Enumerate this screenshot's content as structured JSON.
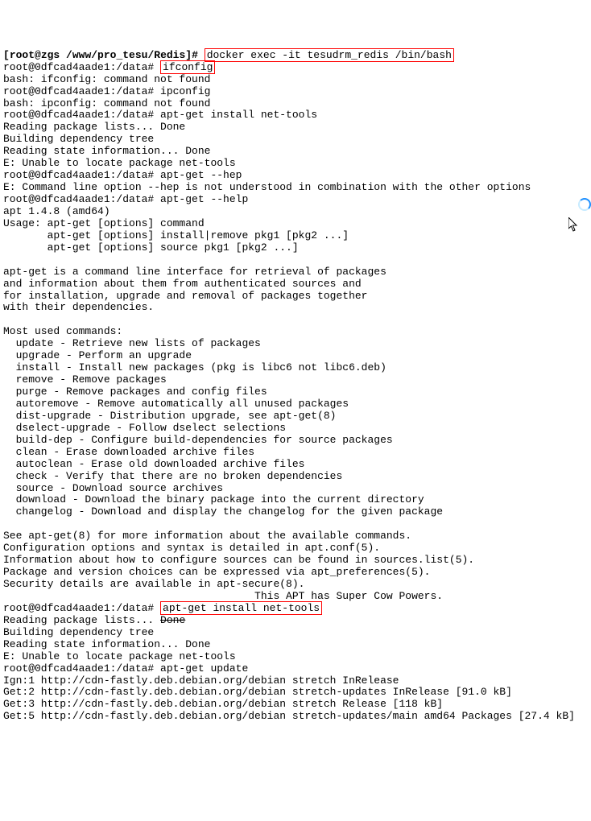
{
  "lines": {
    "l0_a": "[",
    "l0_b": "root@zgs",
    "l0_c": " /www/pro_tesu/",
    "l0_d": "Redis",
    "l0_e": "]# ",
    "l0_cmd": "docker exec -it tesudrm_redis /bin/bash",
    "l1_a": "root@0dfcad4aade1:/data# ",
    "l1_cmd": "ifconfig",
    "l2": "bash: ifconfig: command not found",
    "l3": "root@0dfcad4aade1:/data# ipconfig",
    "l4": "bash: ipconfig: command not found",
    "l5": "root@0dfcad4aade1:/data# apt-get install net-tools",
    "l6": "Reading package lists... Done",
    "l7": "Building dependency tree",
    "l8": "Reading state information... Done",
    "l9": "E: Unable to locate package net-tools",
    "l10": "root@0dfcad4aade1:/data# apt-get --hep",
    "l11": "E: Command line option --hep is not understood in combination with the other options",
    "l12": "root@0dfcad4aade1:/data# apt-get --help",
    "l13": "apt 1.4.8 (amd64)",
    "l14": "Usage: apt-get [options] command",
    "l15": "       apt-get [options] install|remove pkg1 [pkg2 ...]",
    "l16": "       apt-get [options] source pkg1 [pkg2 ...]",
    "l17": "",
    "l18": "apt-get is a command line interface for retrieval of packages",
    "l19": "and information about them from authenticated sources and",
    "l20": "for installation, upgrade and removal of packages together",
    "l21": "with their dependencies.",
    "l22": "",
    "l23": "Most used commands:",
    "l24": "  update - Retrieve new lists of packages",
    "l25": "  upgrade - Perform an upgrade",
    "l26": "  install - Install new packages (pkg is libc6 not libc6.deb)",
    "l27": "  remove - Remove packages",
    "l28": "  purge - Remove packages and config files",
    "l29": "  autoremove - Remove automatically all unused packages",
    "l30": "  dist-upgrade - Distribution upgrade, see apt-get(8)",
    "l31": "  dselect-upgrade - Follow dselect selections",
    "l32": "  build-dep - Configure build-dependencies for source packages",
    "l33": "  clean - Erase downloaded archive files",
    "l34": "  autoclean - Erase old downloaded archive files",
    "l35": "  check - Verify that there are no broken dependencies",
    "l36": "  source - Download source archives",
    "l37": "  download - Download the binary package into the current directory",
    "l38": "  changelog - Download and display the changelog for the given package",
    "l39": "",
    "l40": "See apt-get(8) for more information about the available commands.",
    "l41": "Configuration options and syntax is detailed in apt.conf(5).",
    "l42": "Information about how to configure sources can be found in sources.list(5).",
    "l43": "Package and version choices can be expressed via apt_preferences(5).",
    "l44": "Security details are available in apt-secure(8).",
    "l45": "                                        This APT has Super Cow Powers.",
    "l46_a": "root@0dfcad4aade1:/data# ",
    "l46_cmd": "apt-get install net-tools",
    "l47_a": "Reading package lists... ",
    "l47_b": "Done",
    "l48": "Building dependency tree",
    "l49": "Reading state information... Done",
    "l50": "E: Unable to locate package net-tools",
    "l51": "root@0dfcad4aade1:/data# apt-get update",
    "l52": "Ign:1 http://cdn-fastly.deb.debian.org/debian stretch InRelease",
    "l53": "Get:2 http://cdn-fastly.deb.debian.org/debian stretch-updates InRelease [91.0 kB]",
    "l54": "Get:3 http://cdn-fastly.deb.debian.org/debian stretch Release [118 kB]",
    "l55": "Get:5 http://cdn-fastly.deb.debian.org/debian stretch-updates/main amd64 Packages [27.4 kB]"
  }
}
